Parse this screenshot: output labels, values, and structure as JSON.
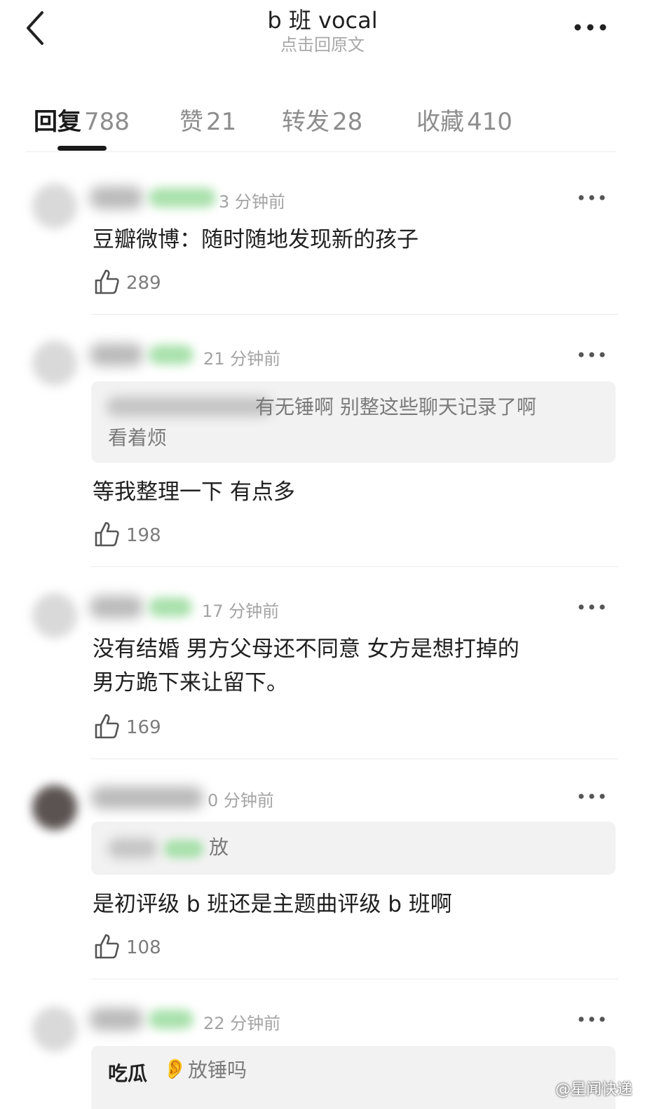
{
  "header": {
    "title": "b 班 vocal",
    "subtitle": "点击回原文"
  },
  "tabs": [
    {
      "label": "回复",
      "count": "788",
      "active": true
    },
    {
      "label": "赞",
      "count": "21",
      "active": false
    },
    {
      "label": "转发",
      "count": "28",
      "active": false
    },
    {
      "label": "收藏",
      "count": "410",
      "active": false
    }
  ],
  "comments": [
    {
      "time": "3 分钟前",
      "text_lines": [
        "豆瓣微博：随时随地发现新的孩子"
      ],
      "likes": "289"
    },
    {
      "time": "21 分钟前",
      "quote_lines": [
        "有无锤啊  别整这些聊天记录了啊",
        "看着烦"
      ],
      "text_lines": [
        "等我整理一下  有点多"
      ],
      "likes": "198"
    },
    {
      "time": "17 分钟前",
      "text_lines": [
        "没有结婚 男方父母还不同意 女方是想打掉的",
        "男方跪下来让留下。"
      ],
      "likes": "169"
    },
    {
      "time": "0 分钟前",
      "quote_lines": [
        "放"
      ],
      "text_lines": [
        "是初评级 b 班还是主题曲评级 b 班啊"
      ],
      "likes": "108"
    },
    {
      "time": "22 分钟前",
      "quote_name": "吃瓜",
      "quote_emoji": "👂",
      "quote_lines": [
        "放锤吗"
      ]
    }
  ],
  "watermark": "@星闻快递",
  "icons": [
    "back-icon",
    "more-icon",
    "thumbs-up-icon",
    "ear-emoji-icon"
  ],
  "colors": {
    "badge_green": "#a9e1ac",
    "quote_bg": "#f2f2f2",
    "time_gray": "#a3a3a3"
  }
}
